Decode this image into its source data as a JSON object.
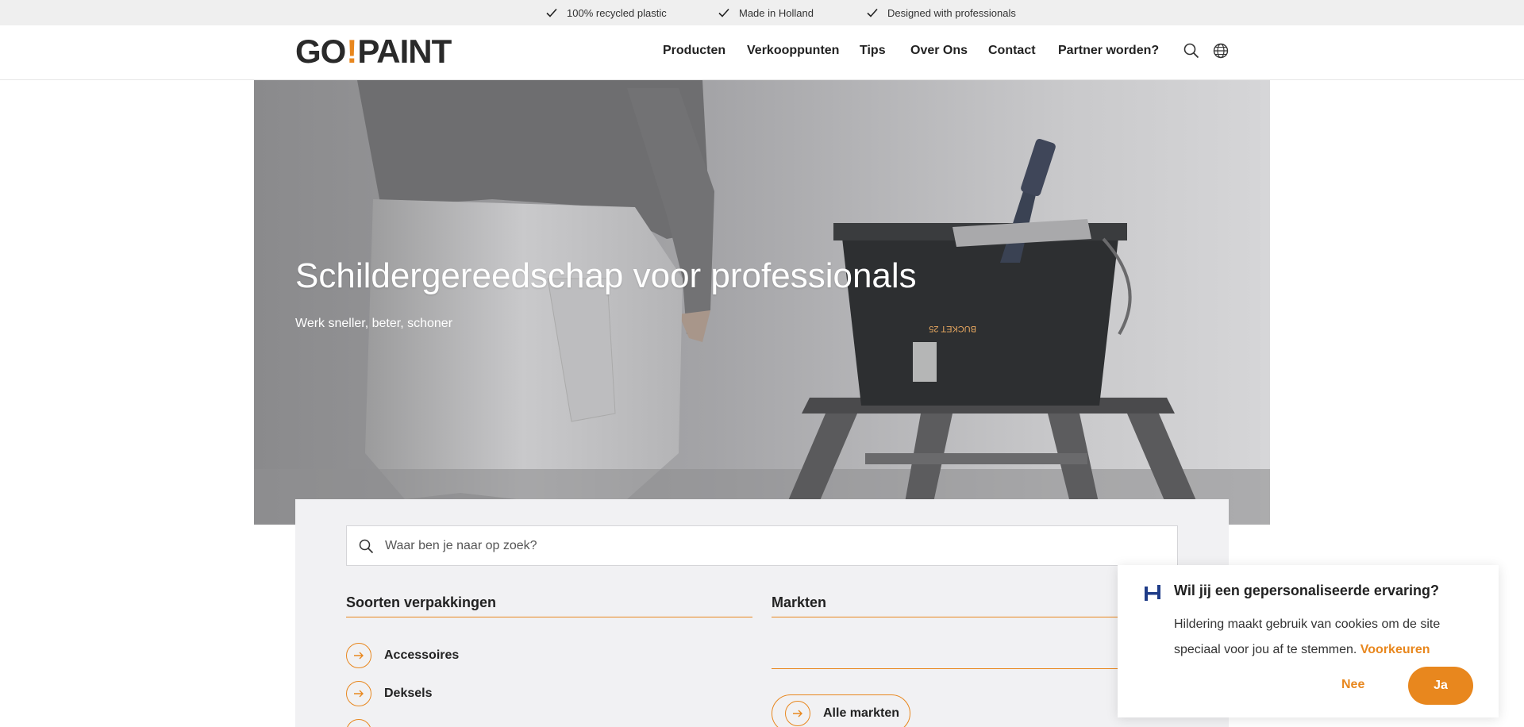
{
  "usp_bar": {
    "items": [
      "100% recycled plastic",
      "Made in Holland",
      "Designed with professionals"
    ]
  },
  "header": {
    "logo_left": "GO",
    "logo_bang": "!",
    "logo_right": "PAINT",
    "nav": [
      "Producten",
      "Verkooppunten",
      "Tips",
      "Over Ons",
      "Contact",
      "Partner worden?"
    ]
  },
  "hero": {
    "title": "Schildergereedschap voor professionals",
    "subtitle": "Werk sneller, beter, schoner",
    "bucket_label": "BUCKET 25"
  },
  "search": {
    "placeholder": "Waar ben je naar op zoek?"
  },
  "packaging": {
    "title": "Soorten verpakkingen",
    "items": [
      "Accessoires",
      "Deksels"
    ]
  },
  "markets": {
    "title": "Markten",
    "all_label": "Alle markten"
  },
  "cookie": {
    "title": "Wil jij een gepersonaliseerde ervaring?",
    "text": "Hildering maakt gebruik van cookies om de site speciaal voor jou af te stemmen.",
    "preferences": "Voorkeuren",
    "no": "Nee",
    "yes": "Ja"
  },
  "colors": {
    "accent": "#e8871e",
    "usp_bg": "#efefef",
    "panel_bg": "#f1f1f3"
  }
}
